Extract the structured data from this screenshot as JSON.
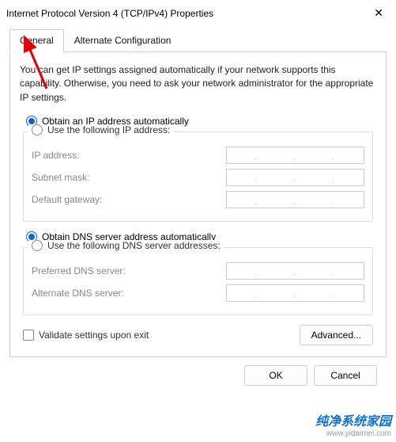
{
  "window": {
    "title": "Internet Protocol Version 4 (TCP/IPv4) Properties"
  },
  "tabs": {
    "general": "General",
    "alternate": "Alternate Configuration"
  },
  "description": "You can get IP settings assigned automatically if your network supports this capability. Otherwise, you need to ask your network administrator for the appropriate IP settings.",
  "ip": {
    "auto": "Obtain an IP address automatically",
    "manual": "Use the following IP address:",
    "addr": "IP address:",
    "mask": "Subnet mask:",
    "gateway": "Default gateway:"
  },
  "dns": {
    "auto": "Obtain DNS server address automatically",
    "manual": "Use the following DNS server addresses:",
    "preferred": "Preferred DNS server:",
    "alternate": "Alternate DNS server:"
  },
  "validate": "Validate settings upon exit",
  "buttons": {
    "advanced": "Advanced...",
    "ok": "OK",
    "cancel": "Cancel"
  },
  "watermark": {
    "text": "纯净系统家园",
    "url": "www.yidaimei.com"
  }
}
